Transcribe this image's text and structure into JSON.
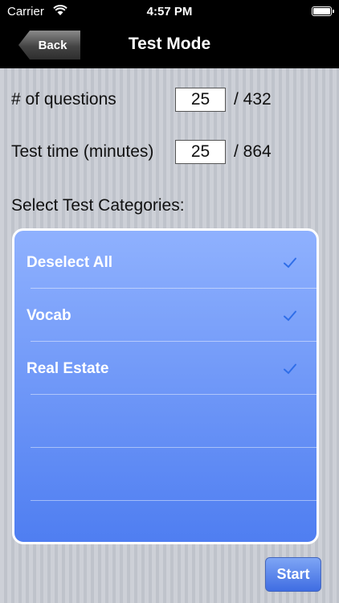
{
  "status_bar": {
    "carrier": "Carrier",
    "time": "4:57 PM"
  },
  "nav": {
    "back_label": "Back",
    "title": "Test Mode"
  },
  "questions": {
    "label": "# of questions",
    "value": "25",
    "total": "/ 432"
  },
  "test_time": {
    "label": "Test time (minutes)",
    "value": "25",
    "total": "/ 864"
  },
  "categories": {
    "heading": "Select Test Categories:",
    "items": [
      {
        "label": "Deselect All",
        "checked": true
      },
      {
        "label": "Vocab",
        "checked": true
      },
      {
        "label": "Real Estate",
        "checked": true
      }
    ]
  },
  "start_label": "Start",
  "colors": {
    "check": "#2f6ee8",
    "list_top": "#8fb1fe",
    "list_bottom": "#4f7ef1"
  }
}
